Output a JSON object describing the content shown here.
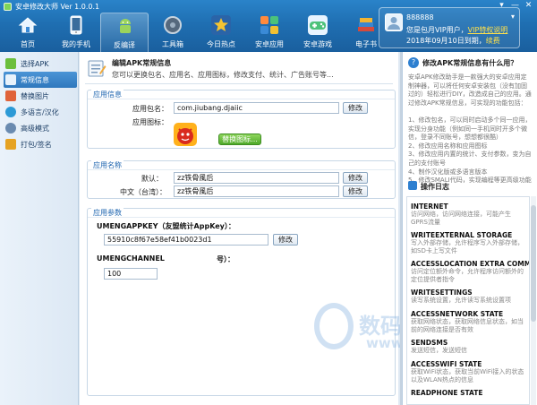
{
  "app": {
    "title": "安卓修改大师 Ver 1.0.0.1"
  },
  "toolbar": {
    "items": [
      {
        "label": "首页",
        "icon": "home-icon",
        "color": "#3a8ad6"
      },
      {
        "label": "我的手机",
        "icon": "phone-icon",
        "color": "#e9f4ff"
      },
      {
        "label": "反编译",
        "icon": "android-icon",
        "color": "#9bd45c"
      },
      {
        "label": "工具箱",
        "icon": "toolbox-icon",
        "color": "#6b7f93"
      },
      {
        "label": "今日热点",
        "icon": "star-icon",
        "color": "#f2b431"
      },
      {
        "label": "安卓应用",
        "icon": "apps-grid-icon",
        "color": "#ff8a3d"
      },
      {
        "label": "安卓游戏",
        "icon": "gamepad-icon",
        "color": "#4cc27a"
      },
      {
        "label": "电子书",
        "icon": "books-icon",
        "color": "#d44a3c"
      }
    ],
    "active_index": 2
  },
  "user": {
    "name": "888888",
    "vip_text": "您是包月VIP用户，",
    "vip_link": "VIP特权说明",
    "expire_text": "2018年09月10日到期，",
    "renew": "续费"
  },
  "sidebar": {
    "items": [
      {
        "label": "选择APK",
        "icon": "select-apk-icon",
        "color": "#6cbf3c"
      },
      {
        "label": "常规信息",
        "icon": "info-icon",
        "color": "#3a86d0"
      },
      {
        "label": "替换图片",
        "icon": "image-icon",
        "color": "#e0633a"
      },
      {
        "label": "多语言/汉化",
        "icon": "globe-icon",
        "color": "#2c9ad6"
      },
      {
        "label": "高级模式",
        "icon": "gear-icon",
        "color": "#6a8bb0"
      },
      {
        "label": "打包/签名",
        "icon": "package-icon",
        "color": "#e6a323"
      }
    ],
    "active_index": 1
  },
  "main": {
    "header": {
      "title": "编辑APK常规信息",
      "subtitle": "您可以更换包名、应用名、应用图标，修改支付、统计、广告账号等..."
    },
    "app_info": {
      "title": "应用信息",
      "package_label": "应用包名：",
      "package_value": "com.jiubang.djaiic",
      "modify": "修改",
      "icon_label": "应用图标：",
      "replace_icon": "替换图标..."
    },
    "app_name": {
      "title": "应用名称",
      "default_label": "默认：",
      "default_value": "zz铁骨風后",
      "zh_tw_label": "中文（台湾）：",
      "zh_tw_value": "zz铁骨風后",
      "modify": "修改"
    },
    "app_params": {
      "title": "应用参数",
      "param1_label": "UMENGAPPKEY（友盟统计AppKey）：",
      "param1_value": "55910c8f67e58ef41b0023d1",
      "param2_label": "UMENGCHANNEL",
      "param2_label_tail": "号）：",
      "param2_value": "100",
      "modify": "修改"
    }
  },
  "right_panel": {
    "title": "修改APK常规信息有什么用？",
    "description": "安卓APK修改助手是一款强大的安卓应用定制神器，可以将任何安卓安装包（没有加固过的）轻松进行DIY，改造成自己的应用。通过修改APK常规信息，可实现的功能包括：\n\n1、修改包名，可以同时启动多个同一应用，实现分身功能（例如同一手机同时开多个微信，登录不同账号，想想都很酷）\n2、修改应用名称和应用图标\n3、修改应用内置的统计、支付参数，变为自己的支付账号\n4、制作汉化版或多语言版本\n5、修改SMALI代码，实现编程等更高级功能",
    "log_title": "操作日志",
    "permissions": [
      {
        "name": "INTERNET",
        "desc": "访问网络，访问网络连接，可能产生GPRS流量"
      },
      {
        "name": "WRITEEXTERNAL STORAGE",
        "desc": "写入外部存储，允许程序写入外部存储，如SD卡上写文件"
      },
      {
        "name": "ACCESSLOCATION EXTRA COMM",
        "desc": "访问定位额外命令，允许程序访问额外的定位提供者指令"
      },
      {
        "name": "WRITESETTINGS",
        "desc": "读写系统设置，允许读写系统设置项"
      },
      {
        "name": "ACCESSNETWORK STATE",
        "desc": "获取网络状态，获取网络信息状态，如当前的网络连接是否有效"
      },
      {
        "name": "SENDSMS",
        "desc": "发送短信，发送短信"
      },
      {
        "name": "ACCESSWIFI STATE",
        "desc": "获取WiFi状态，获取当前WiFi接入的状态以及WLAN热点的信息"
      },
      {
        "name": "READPHONE STATE",
        "desc": ""
      }
    ]
  },
  "watermark": {
    "main": "数码资源网",
    "url": "www.smzy.com"
  }
}
